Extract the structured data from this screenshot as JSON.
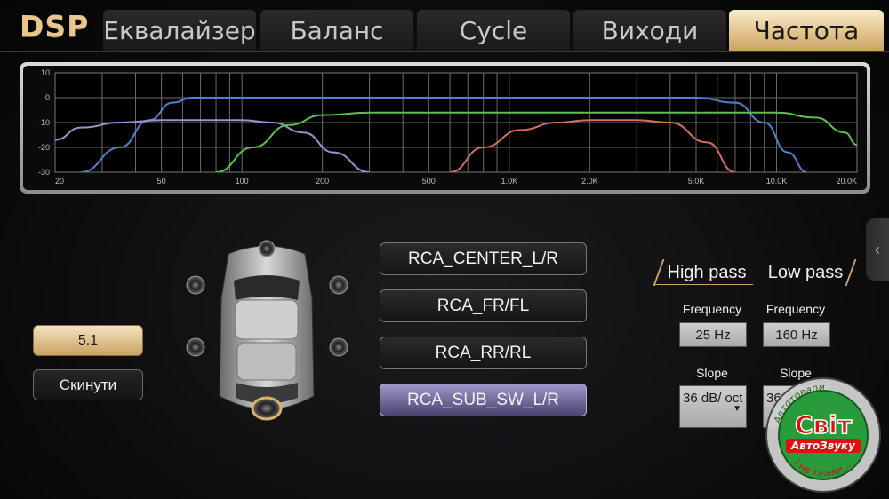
{
  "app": {
    "logo": "DSP"
  },
  "tabs": [
    {
      "label": "Еквалайзер",
      "active": false
    },
    {
      "label": "Баланс",
      "active": false
    },
    {
      "label": "Cycle",
      "active": false
    },
    {
      "label": "Виходи",
      "active": false
    },
    {
      "label": "Частота",
      "active": true
    }
  ],
  "chart_data": {
    "type": "line",
    "xscale": "log",
    "xlim": [
      20,
      20000
    ],
    "ylim": [
      -30,
      10
    ],
    "x_ticks": [
      "20",
      "50",
      "100",
      "200",
      "500",
      "1.0K",
      "2.0K",
      "5.0K",
      "10.0K",
      "20.0K"
    ],
    "y_ticks": [
      "10",
      "0",
      "-10",
      "-20",
      "-30"
    ],
    "grid": true,
    "series": [
      {
        "color": "#4f7fd0",
        "x": [
          25,
          35,
          45,
          55,
          65,
          100,
          1000,
          5000,
          7000,
          9000,
          11000,
          13000
        ],
        "y": [
          -30,
          -20,
          -9,
          -2,
          0,
          0,
          0,
          0,
          -2,
          -10,
          -22,
          -30
        ]
      },
      {
        "color": "#9a93c8",
        "x": [
          20,
          25,
          35,
          50,
          100,
          130,
          170,
          220,
          300
        ],
        "y": [
          -17,
          -12,
          -10,
          -9,
          -9,
          -10,
          -14,
          -22,
          -30
        ]
      },
      {
        "color": "#5cc04a",
        "x": [
          80,
          110,
          150,
          200,
          300,
          1000,
          10000,
          14000,
          18000,
          20000
        ],
        "y": [
          -30,
          -20,
          -11,
          -7,
          -6,
          -6,
          -6,
          -8,
          -14,
          -19
        ]
      },
      {
        "color": "#d07060",
        "x": [
          600,
          800,
          1100,
          1500,
          2000,
          3000,
          4000,
          5500,
          7000
        ],
        "y": [
          -30,
          -20,
          -13,
          -10,
          -9,
          -9,
          -10,
          -18,
          -30
        ]
      }
    ]
  },
  "mode_button": "5.1",
  "reset_button": "Скинути",
  "channels": [
    {
      "label": "RCA_CENTER_L/R",
      "active": false
    },
    {
      "label": "RCA_FR/FL",
      "active": false
    },
    {
      "label": "RCA_RR/RL",
      "active": false
    },
    {
      "label": "RCA_SUB_SW_L/R",
      "active": true
    }
  ],
  "high_pass": {
    "title": "High pass",
    "frequency_label": "Frequency",
    "frequency": "25 Hz",
    "slope_label": "Slope",
    "slope": "36 dB/ oct"
  },
  "low_pass": {
    "title": "Low pass",
    "frequency_label": "Frequency",
    "frequency": "160 Hz",
    "slope_label": "Slope",
    "slope": "36 dB/ oct"
  },
  "watermark": {
    "top": "Світ",
    "sub": "АвтоЗвуку",
    "ring_top": "Автотовари",
    "ring_bottom": "і не тільки..."
  },
  "colors": {
    "accent_gold": "#e2c48c",
    "active_channel": "#7c74aa"
  }
}
